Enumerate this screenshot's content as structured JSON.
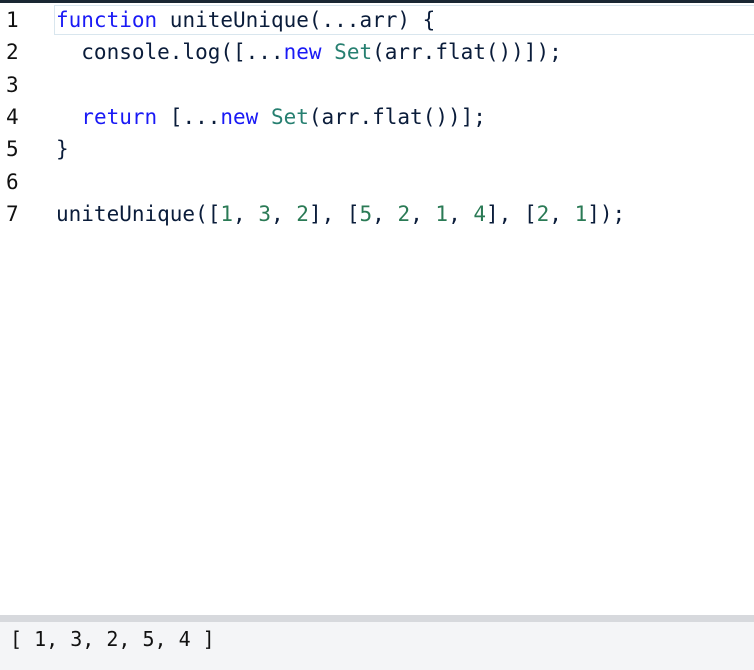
{
  "editor": {
    "lines": [
      {
        "number": "1",
        "tokens": [
          {
            "text": "function",
            "kind": "kw"
          },
          {
            "text": " uniteUnique(...arr) {",
            "kind": "plain"
          }
        ]
      },
      {
        "number": "2",
        "tokens": [
          {
            "text": "  console.log([...",
            "kind": "plain"
          },
          {
            "text": "new",
            "kind": "kw"
          },
          {
            "text": " ",
            "kind": "plain"
          },
          {
            "text": "Set",
            "kind": "cls"
          },
          {
            "text": "(arr.flat())]);",
            "kind": "plain"
          }
        ]
      },
      {
        "number": "3",
        "tokens": []
      },
      {
        "number": "4",
        "tokens": [
          {
            "text": "  ",
            "kind": "plain"
          },
          {
            "text": "return",
            "kind": "kw"
          },
          {
            "text": " [...",
            "kind": "plain"
          },
          {
            "text": "new",
            "kind": "kw"
          },
          {
            "text": " ",
            "kind": "plain"
          },
          {
            "text": "Set",
            "kind": "cls"
          },
          {
            "text": "(arr.flat())];",
            "kind": "plain"
          }
        ]
      },
      {
        "number": "5",
        "tokens": [
          {
            "text": "}",
            "kind": "plain"
          }
        ]
      },
      {
        "number": "6",
        "tokens": []
      },
      {
        "number": "7",
        "tokens": [
          {
            "text": "uniteUnique([",
            "kind": "plain"
          },
          {
            "text": "1",
            "kind": "num"
          },
          {
            "text": ", ",
            "kind": "plain"
          },
          {
            "text": "3",
            "kind": "num"
          },
          {
            "text": ", ",
            "kind": "plain"
          },
          {
            "text": "2",
            "kind": "num"
          },
          {
            "text": "], [",
            "kind": "plain"
          },
          {
            "text": "5",
            "kind": "num"
          },
          {
            "text": ", ",
            "kind": "plain"
          },
          {
            "text": "2",
            "kind": "num"
          },
          {
            "text": ", ",
            "kind": "plain"
          },
          {
            "text": "1",
            "kind": "num"
          },
          {
            "text": ", ",
            "kind": "plain"
          },
          {
            "text": "4",
            "kind": "num"
          },
          {
            "text": "], [",
            "kind": "plain"
          },
          {
            "text": "2",
            "kind": "num"
          },
          {
            "text": ", ",
            "kind": "plain"
          },
          {
            "text": "1",
            "kind": "num"
          },
          {
            "text": "]);",
            "kind": "plain"
          }
        ]
      }
    ]
  },
  "console": {
    "output": "[ 1, 3, 2, 5, 4 ]"
  },
  "colors": {
    "keyword": "#1a1af5",
    "class": "#267f70",
    "number": "#2a7a55",
    "text": "#0a1c3a"
  }
}
